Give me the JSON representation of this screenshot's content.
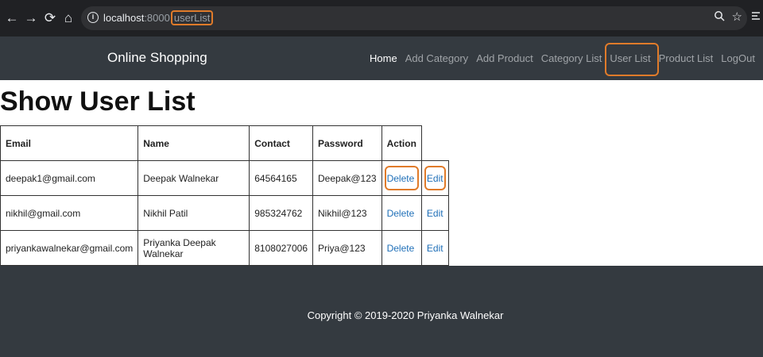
{
  "browser": {
    "back_icon": "←",
    "forward_icon": "→",
    "reload_icon": "⟳",
    "home_icon": "⌂",
    "url_host": "localhost",
    "url_port": ":8000",
    "url_path": "userList",
    "highlight_color": "#e07b2a"
  },
  "navbar": {
    "brand": "Online Shopping",
    "links": [
      {
        "label": "Home",
        "active": true
      },
      {
        "label": "Add Category",
        "active": false
      },
      {
        "label": "Add Product",
        "active": false
      },
      {
        "label": "Category List",
        "active": false
      },
      {
        "label": "User List",
        "active": false,
        "highlighted": true
      },
      {
        "label": "Product List",
        "active": false
      },
      {
        "label": "LogOut",
        "active": false
      }
    ]
  },
  "main": {
    "title": "Show User List",
    "table": {
      "headers": [
        "Email",
        "Name",
        "Contact",
        "Password",
        "Action"
      ],
      "rows": [
        {
          "email": "deepak1@gmail.com",
          "name": "Deepak Walnekar",
          "contact": "64564165",
          "password": "Deepak@123",
          "delete": "Delete",
          "edit": "Edit"
        },
        {
          "email": "nikhil@gmail.com",
          "name": "Nikhil Patil",
          "contact": "985324762",
          "password": "Nikhil@123",
          "delete": "Delete",
          "edit": "Edit"
        },
        {
          "email": "priyankawalnekar@gmail.com",
          "name": "Priyanka Deepak Walnekar",
          "contact": "8108027006",
          "password": "Priya@123",
          "delete": "Delete",
          "edit": "Edit"
        }
      ]
    }
  },
  "footer": {
    "text": "Copyright © 2019-2020 Priyanka Walnekar"
  },
  "colors": {
    "navbar_bg": "#343a40",
    "link_color": "#1f6fb8"
  }
}
